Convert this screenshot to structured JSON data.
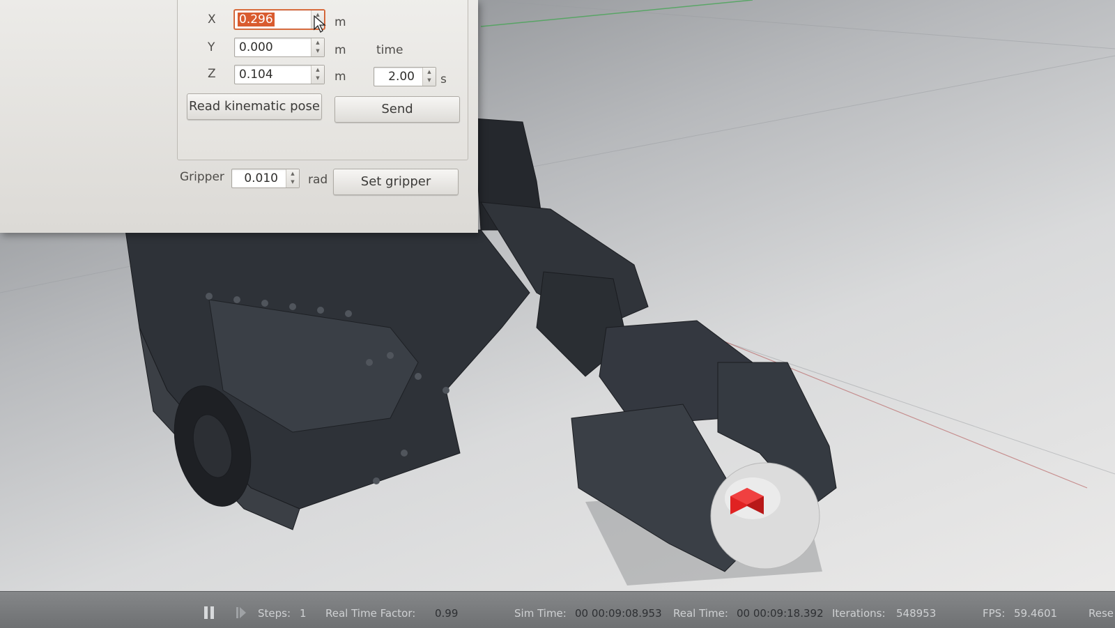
{
  "pose": {
    "x_label": "X",
    "x_value": "0.296",
    "y_label": "Y",
    "y_value": "0.000",
    "z_label": "Z",
    "z_value": "0.104",
    "unit_m": "m",
    "time_label": "time",
    "time_value": "2.00",
    "time_unit": "s",
    "read_button": "Read kinematic pose",
    "send_button": "Send"
  },
  "gripper": {
    "label": "Gripper",
    "value": "0.010",
    "unit": "rad",
    "set_button": "Set gripper"
  },
  "status": {
    "steps_label": "Steps:",
    "steps_value": "1",
    "rtf_label": "Real Time Factor:",
    "rtf_value": "0.99",
    "sim_time_label": "Sim Time:",
    "sim_time_value": "00 00:09:08.953",
    "real_time_label": "Real Time:",
    "real_time_value": "00 00:09:18.392",
    "iterations_label": "Iterations:",
    "iterations_value": "548953",
    "fps_label": "FPS:",
    "fps_value": "59.4601",
    "reset_label": "Rese"
  },
  "icons": {
    "pause": "pause-icon",
    "step": "step-icon",
    "cursor": "mouse-pointer-icon",
    "spin": "spin-arrows-icon"
  },
  "colors": {
    "selection": "#d95b2f",
    "target_cube": "#e02222",
    "robot": "#2e3238"
  }
}
